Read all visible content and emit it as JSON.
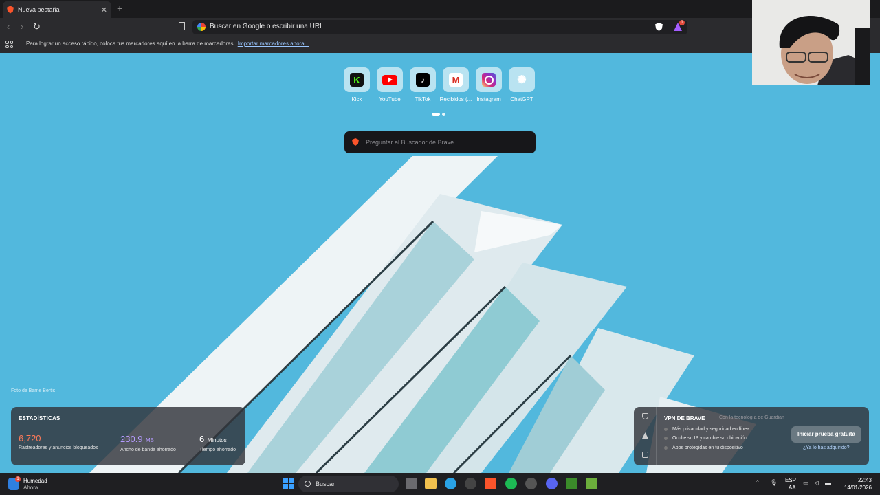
{
  "browser": {
    "tab_title": "Nueva pestaña",
    "tab_close_glyph": "✕",
    "new_tab_glyph": "+",
    "omnibox_placeholder": "Buscar en Google o escribir una URL",
    "bookmarks_bar_text": "Para lograr un acceso rápido, coloca tus marcadores aquí en la barra de marcadores.",
    "bookmarks_import_link": "Importar marcadores ahora...",
    "rewards_badge": "1"
  },
  "top_sites": [
    {
      "label": "Kick",
      "icon": "kick-icon",
      "glyph": "K"
    },
    {
      "label": "YouTube",
      "icon": "youtube-icon",
      "glyph": ""
    },
    {
      "label": "TikTok",
      "icon": "tiktok-icon",
      "glyph": "♪"
    },
    {
      "label": "Recibidos (...",
      "icon": "gmail-icon",
      "glyph": "M"
    },
    {
      "label": "Instagram",
      "icon": "instagram-icon",
      "glyph": ""
    },
    {
      "label": "ChatGPT",
      "icon": "chatgpt-icon",
      "glyph": "✺"
    }
  ],
  "search": {
    "placeholder": "Preguntar al Buscador de Brave"
  },
  "photo_credit": "Foto de Barne Bertis",
  "stats": {
    "heading": "ESTADÍSTICAS",
    "trackers": {
      "value": "6,720",
      "caption": "Rastreadores y anuncios bloqueados",
      "color": "#ff7a59"
    },
    "bandwidth": {
      "value": "230.9",
      "unit": "MB",
      "caption": "Ancho de banda ahorrado",
      "color": "#b59bff"
    },
    "time": {
      "value": "6",
      "unit": "Minutos",
      "caption": "Tiempo ahorrado",
      "color": "#ffffff"
    }
  },
  "vpn": {
    "title": "VPN DE BRAVE",
    "powered_by": "Con la tecnología de Guardian",
    "features": [
      "Más privacidad y seguridad en línea",
      "Oculte su IP y cambie su ubicación",
      "Apps protegidas en tu dispositivo"
    ],
    "cta": "Iniciar prueba gratuita",
    "already": "¿Ya lo has adquirido?"
  },
  "taskbar": {
    "weather_title": "Humedad",
    "weather_sub": "Ahora",
    "weather_badge": "1",
    "search_label": "Buscar",
    "lang_1": "ESP",
    "lang_2": "LAA",
    "time": "22:43",
    "date": "14/01/2026",
    "tray_chevron": "⌃"
  },
  "colors": {
    "accent_brave": "#fb542b",
    "sky": "#52b8dd"
  }
}
